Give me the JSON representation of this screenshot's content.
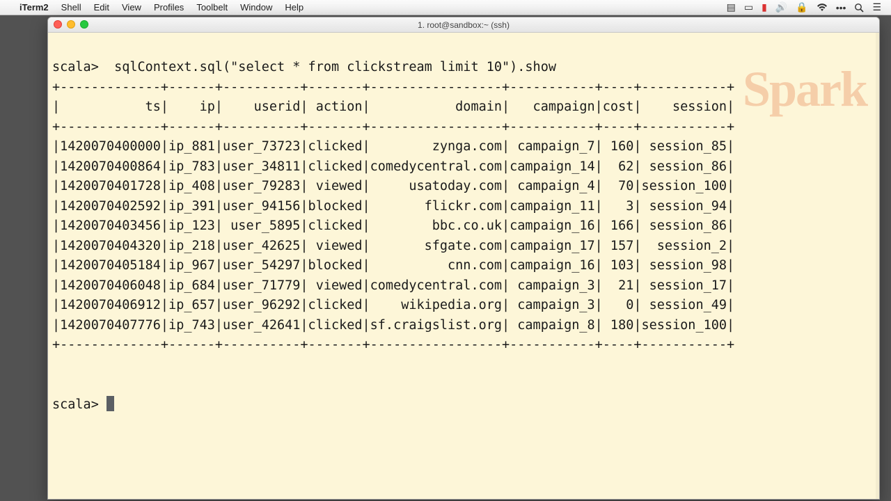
{
  "menubar": {
    "app": "iTerm2",
    "items": [
      "Shell",
      "Edit",
      "View",
      "Profiles",
      "Toolbelt",
      "Window",
      "Help"
    ]
  },
  "window": {
    "title": "1. root@sandbox:~ (ssh)"
  },
  "watermark": "Spark",
  "terminal": {
    "prompt": "scala>",
    "command": "sqlContext.sql(\"select * from clickstream limit 10\").show",
    "columns": [
      "ts",
      "ip",
      "userid",
      "action",
      "domain",
      "campaign",
      "cost",
      "session"
    ],
    "widths": [
      13,
      6,
      10,
      7,
      17,
      11,
      4,
      11
    ],
    "rows": [
      {
        "ts": "1420070400000",
        "ip": "ip_881",
        "userid": "user_73723",
        "action": "clicked",
        "domain": "zynga.com",
        "campaign": "campaign_7",
        "cost": "160",
        "session": "session_85"
      },
      {
        "ts": "1420070400864",
        "ip": "ip_783",
        "userid": "user_34811",
        "action": "clicked",
        "domain": "comedycentral.com",
        "campaign": "campaign_14",
        "cost": "62",
        "session": "session_86"
      },
      {
        "ts": "1420070401728",
        "ip": "ip_408",
        "userid": "user_79283",
        "action": "viewed",
        "domain": "usatoday.com",
        "campaign": "campaign_4",
        "cost": "70",
        "session": "session_100"
      },
      {
        "ts": "1420070402592",
        "ip": "ip_391",
        "userid": "user_94156",
        "action": "blocked",
        "domain": "flickr.com",
        "campaign": "campaign_11",
        "cost": "3",
        "session": "session_94"
      },
      {
        "ts": "1420070403456",
        "ip": "ip_123",
        "userid": "user_5895",
        "action": "clicked",
        "domain": "bbc.co.uk",
        "campaign": "campaign_16",
        "cost": "166",
        "session": "session_86"
      },
      {
        "ts": "1420070404320",
        "ip": "ip_218",
        "userid": "user_42625",
        "action": "viewed",
        "domain": "sfgate.com",
        "campaign": "campaign_17",
        "cost": "157",
        "session": "session_2"
      },
      {
        "ts": "1420070405184",
        "ip": "ip_967",
        "userid": "user_54297",
        "action": "blocked",
        "domain": "cnn.com",
        "campaign": "campaign_16",
        "cost": "103",
        "session": "session_98"
      },
      {
        "ts": "1420070406048",
        "ip": "ip_684",
        "userid": "user_71779",
        "action": "viewed",
        "domain": "comedycentral.com",
        "campaign": "campaign_3",
        "cost": "21",
        "session": "session_17"
      },
      {
        "ts": "1420070406912",
        "ip": "ip_657",
        "userid": "user_96292",
        "action": "clicked",
        "domain": "wikipedia.org",
        "campaign": "campaign_3",
        "cost": "0",
        "session": "session_49"
      },
      {
        "ts": "1420070407776",
        "ip": "ip_743",
        "userid": "user_42641",
        "action": "clicked",
        "domain": "sf.craigslist.org",
        "campaign": "campaign_8",
        "cost": "180",
        "session": "session_100"
      }
    ]
  }
}
